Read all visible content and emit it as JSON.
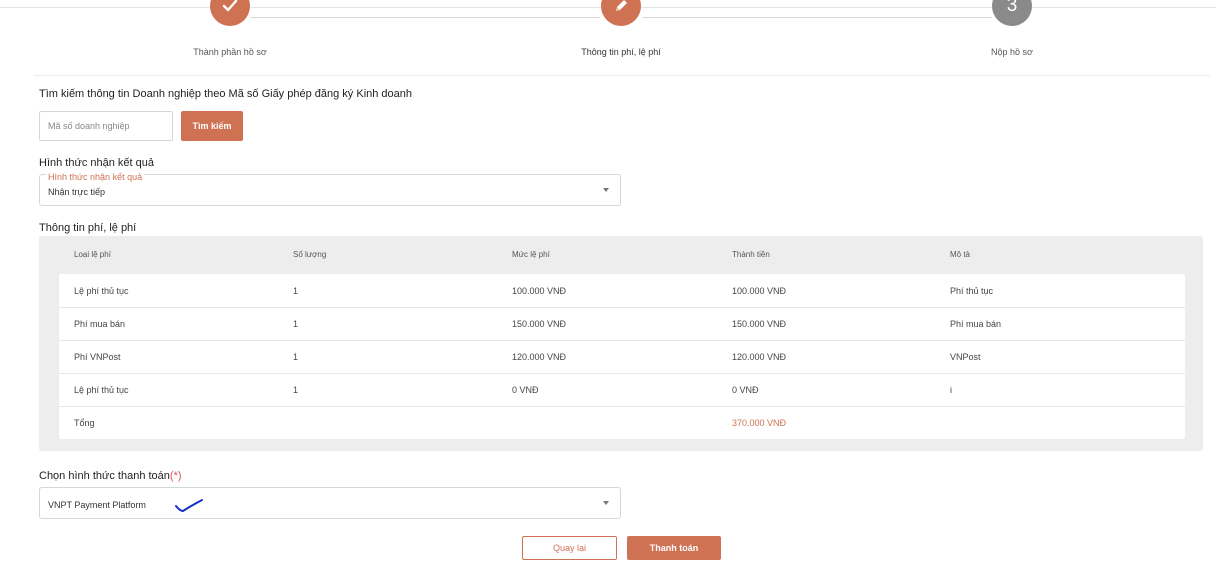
{
  "steps": [
    {
      "label": "Thành phần hồ sơ",
      "icon": "check-icon",
      "state": "done"
    },
    {
      "label": "Thông tin phí, lệ phí",
      "icon": "pencil-icon",
      "state": "active"
    },
    {
      "label": "Nộp hồ sơ",
      "number": "3",
      "state": "pending"
    }
  ],
  "search": {
    "title": "Tìm kiếm thông tin Doanh nghiệp theo Mã số Giấy phép đăng ký Kinh doanh",
    "placeholder": "Mã số doanh nghiệp",
    "button_label": "Tìm kiếm"
  },
  "receive": {
    "section_title": "Hình thức nhận kết quả",
    "field_label": "Hình thức nhận kết quả",
    "value": "Nhận trực tiếp"
  },
  "fees": {
    "section_title": "Thông tin phí, lệ phí",
    "headers": [
      "Loại lệ phí",
      "Số lượng",
      "Mức lệ phí",
      "Thành tiền",
      "Mô tả"
    ],
    "rows": [
      [
        "Lệ phí thủ tục",
        "1",
        "100.000 VNĐ",
        "100.000 VNĐ",
        "Phí thủ tục"
      ],
      [
        "Phí mua bán",
        "1",
        "150.000 VNĐ",
        "150.000 VNĐ",
        "Phí mua bán"
      ],
      [
        "Phí VNPost",
        "1",
        "120.000 VNĐ",
        "120.000 VNĐ",
        "VNPost"
      ],
      [
        "Lệ phí thủ tục",
        "1",
        "0 VNĐ",
        "0 VNĐ",
        "i"
      ]
    ],
    "total_label": "Tổng",
    "total_value": "370.000 VNĐ"
  },
  "payment": {
    "section_title": "Chọn hình thức thanh toán",
    "required_mark": "(*)",
    "value": "VNPT Payment Platform"
  },
  "actions": {
    "back_label": "Quay lại",
    "pay_label": "Thanh toán"
  },
  "colors": {
    "accent": "#cf7253",
    "pending_step": "#8a8a8a",
    "panel_bg": "#ededed"
  }
}
